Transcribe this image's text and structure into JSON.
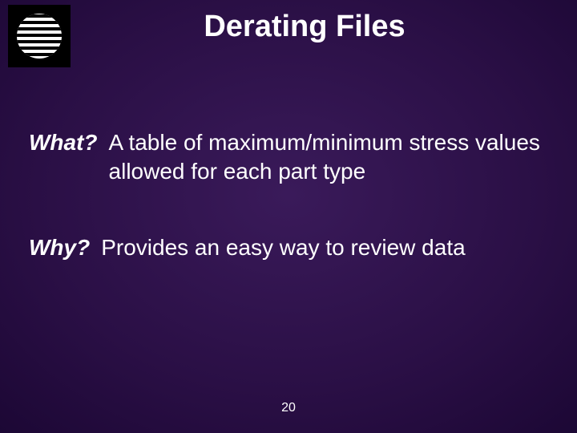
{
  "slide": {
    "title": "Derating Files",
    "items": [
      {
        "label": "What?",
        "text": "A table of maximum/minimum stress values allowed for each part type"
      },
      {
        "label": "Why?",
        "text": "Provides an easy way to review data"
      }
    ],
    "page_number": "20"
  },
  "icons": {
    "logo": "striped-circle-logo"
  }
}
